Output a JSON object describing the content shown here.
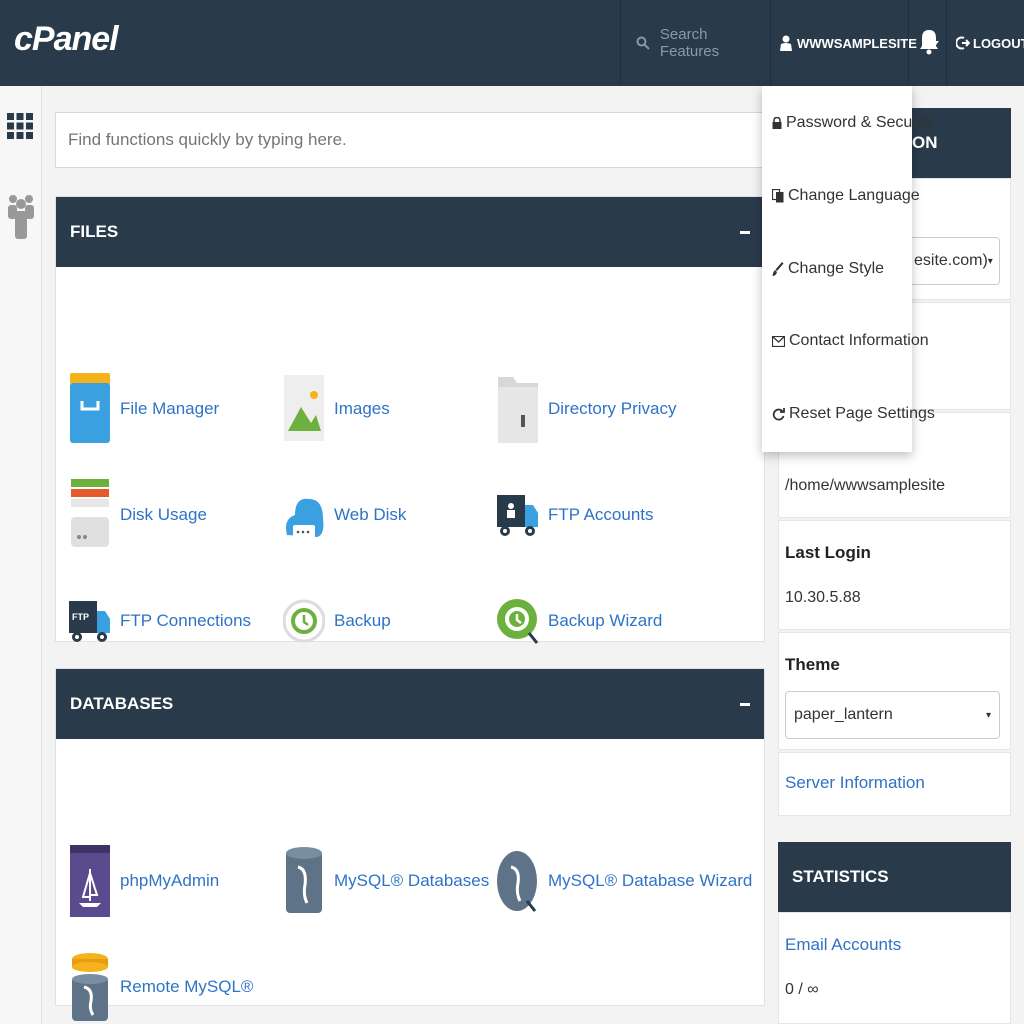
{
  "header": {
    "logo": "cPanel",
    "search_placeholder": "Search Features",
    "username": "WWWSAMPLESITE",
    "logout": "LOGOUT"
  },
  "quick_find": {
    "placeholder": "Find functions quickly by typing here."
  },
  "sections": {
    "files": {
      "title": "FILES",
      "items": [
        "File Manager",
        "Images",
        "Directory Privacy",
        "Disk Usage",
        "Web Disk",
        "FTP Accounts",
        "FTP Connections",
        "Backup",
        "Backup Wizard"
      ]
    },
    "databases": {
      "title": "DATABASES",
      "items": [
        "phpMyAdmin",
        "MySQL® Databases",
        "MySQL® Database Wizard",
        "Remote MySQL®"
      ]
    }
  },
  "user_dropdown": {
    "items": [
      "Password & Security",
      "Change Language",
      "Change Style",
      "Contact Information",
      "Reset Page Settings"
    ]
  },
  "sidebar": {
    "general_header_visible": "ON",
    "domain_select_visible": "esite.com)",
    "home_dir_value": "/home/wwwsamplesite",
    "last_login_label": "Last Login",
    "last_login_value": "10.30.5.88",
    "theme_label": "Theme",
    "theme_value": "paper_lantern",
    "server_info_link": "Server Information",
    "statistics_title": "STATISTICS",
    "email_accounts_label": "Email Accounts",
    "email_accounts_value": "0 / ∞"
  },
  "colors": {
    "navbar": "#293a4a",
    "link": "#2f73c7",
    "background": "#f3f3f3"
  }
}
